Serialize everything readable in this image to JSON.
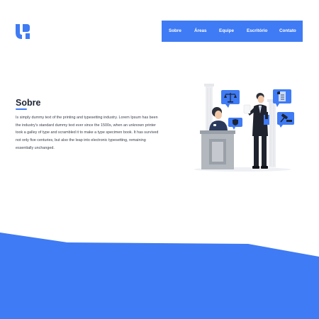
{
  "brand": {
    "color": "#3f7bf4",
    "logo_icon": "logo-icon"
  },
  "nav": {
    "items": [
      "Sobre",
      "Áreas",
      "Equipe",
      "Escritório",
      "Contato"
    ]
  },
  "about": {
    "title": "Sobre",
    "body": "Is simply dummy text of the printing and typesetting industry. Lorem Ipsum has been the industry's standard dummy text ever since the 1500s, when an unknown printer took a galley of type and scrambled it to make a type specimen book. It has survived not only five centuries, but also the leap into electronic typesetting, remaining essentially unchanged."
  },
  "colors": {
    "accent": "#3f7bf4",
    "heading": "#1d2433",
    "text": "#3a3f4b",
    "background": "#ffffff"
  },
  "illustration": {
    "name": "lawyer-office-illustration"
  }
}
